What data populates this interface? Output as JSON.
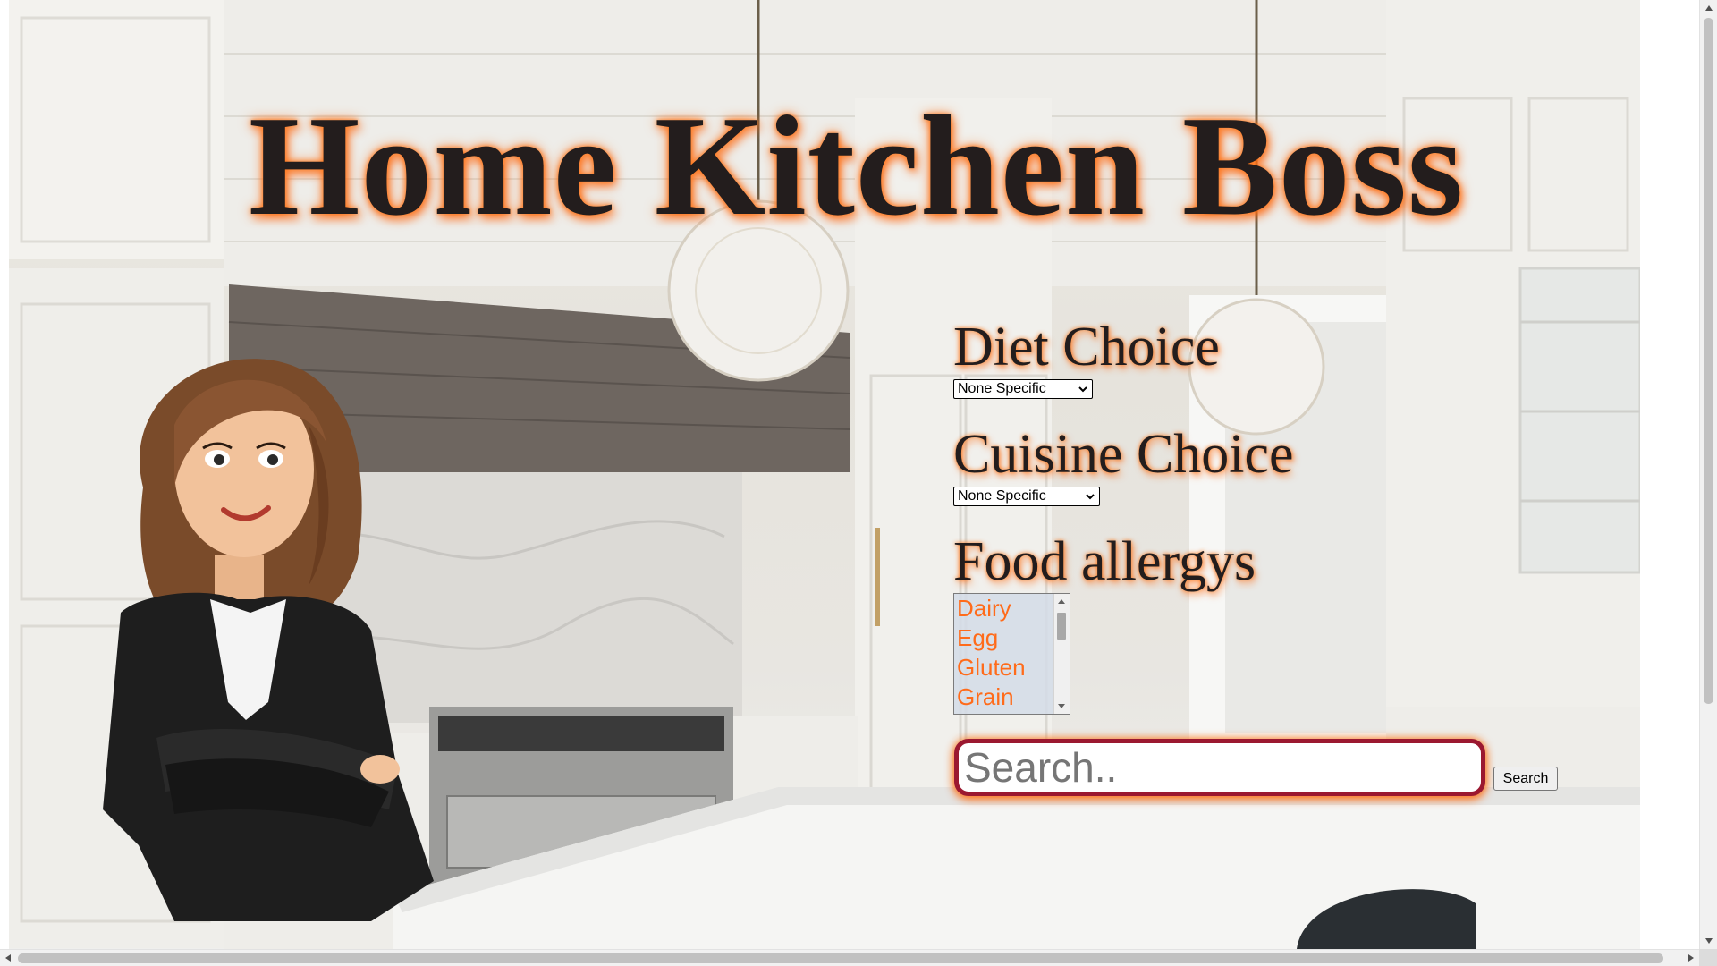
{
  "header": {
    "title": "Home Kitchen Boss"
  },
  "form": {
    "diet": {
      "heading": "Diet Choice",
      "selected": "None Specific"
    },
    "cuisine": {
      "heading": "Cuisine Choice",
      "selected": "None Specific"
    },
    "allergies": {
      "heading": "Food allergys",
      "options": [
        "Dairy",
        "Egg",
        "Gluten",
        "Grain"
      ]
    },
    "search": {
      "placeholder": "Search..",
      "button_label": "Search"
    }
  },
  "colors": {
    "title_text": "#231d1d",
    "title_glow": "#ff7a1c",
    "search_border": "#9b1830",
    "allergy_text": "#ff6b1a"
  },
  "icons": {
    "select_arrow": "chevron-down-icon"
  }
}
